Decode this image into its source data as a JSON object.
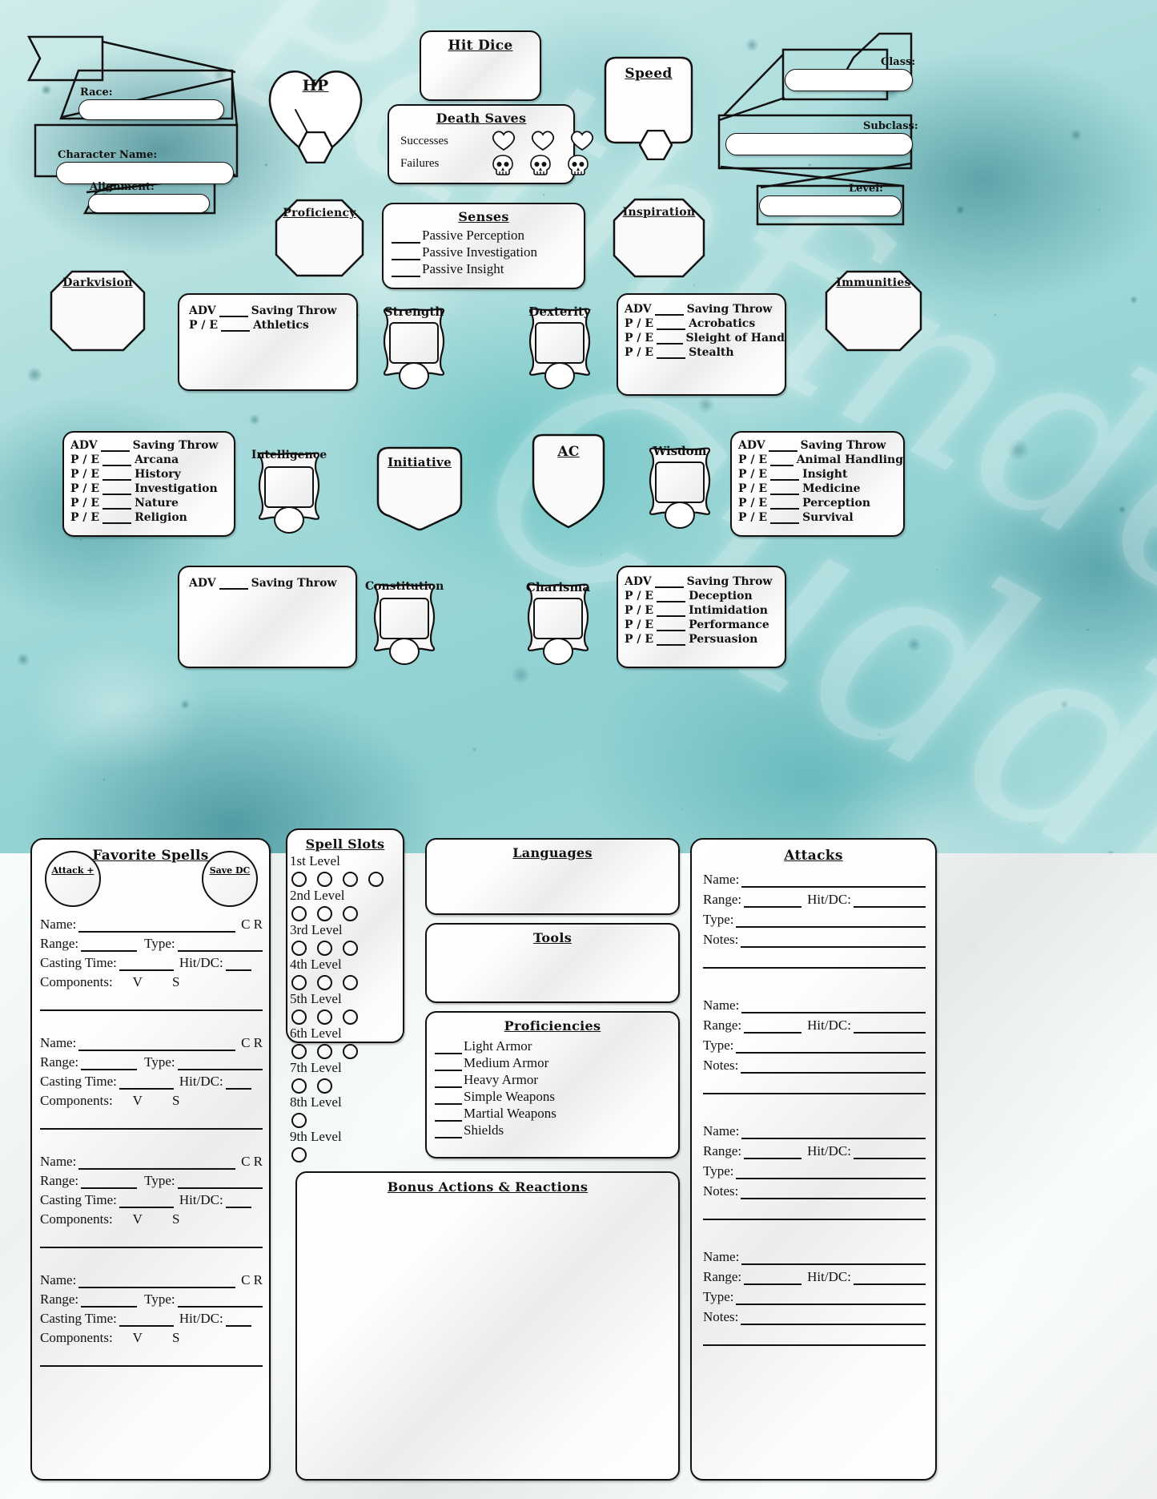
{
  "theme": {
    "accent": "#1a7d8a",
    "ink": "#111111",
    "paper": "#ffffff",
    "bg_teal_dark": "#0d5560",
    "bg_teal_mid": "#3aa3a6",
    "bg_teal_light": "#cfeceb"
  },
  "watermark": {
    "line1": "Pathfinder",
    "line2": "Cuddle"
  },
  "identity": {
    "race_label": "Race:",
    "character_name_label": "Character Name:",
    "alignment_label": "Alignment:",
    "class_label": "Class:",
    "subclass_label": "Subclass:",
    "level_label": "Level:",
    "race_value": "",
    "character_name_value": "",
    "alignment_value": "",
    "class_value": "",
    "subclass_value": "",
    "level_value": ""
  },
  "vitals": {
    "hp_title": "HP",
    "hp_current": "",
    "hp_max": "",
    "hp_temp": "",
    "hit_dice_title": "Hit Dice",
    "hit_dice_value": "",
    "speed_title": "Speed",
    "speed_value": "",
    "speed_bonus": "",
    "proficiency_title": "Proficiency",
    "proficiency_value": "",
    "inspiration_title": "Inspiration",
    "inspiration_value": "",
    "darkvision_title": "Darkvision",
    "darkvision_value": "",
    "immunities_title": "Immunities",
    "immunities_value": "",
    "ac_title": "AC",
    "ac_value": "",
    "initiative_title": "Initiative",
    "initiative_value": ""
  },
  "death_saves": {
    "title": "Death Saves",
    "successes_label": "Successes",
    "failures_label": "Failures",
    "success_count": 3,
    "failure_count": 3,
    "success_icon": "heart-icon",
    "failure_icon": "skull-icon"
  },
  "senses": {
    "title": "Senses",
    "items": [
      "Passive Perception",
      "Passive Investigation",
      "Passive Insight"
    ]
  },
  "abilities": [
    {
      "name": "Strength",
      "score": "",
      "modifier": ""
    },
    {
      "name": "Dexterity",
      "score": "",
      "modifier": ""
    },
    {
      "name": "Intelligence",
      "score": "",
      "modifier": ""
    },
    {
      "name": "Wisdom",
      "score": "",
      "modifier": ""
    },
    {
      "name": "Constitution",
      "score": "",
      "modifier": ""
    },
    {
      "name": "Charisma",
      "score": "",
      "modifier": ""
    }
  ],
  "skill_blocks": {
    "adv_prefix": "ADV",
    "pe_prefix": "P / E",
    "saving_throw_label": "Saving Throw",
    "strength": {
      "ability": "Strength",
      "skills": [
        "Athletics"
      ]
    },
    "dexterity": {
      "ability": "Dexterity",
      "skills": [
        "Acrobatics",
        "Sleight of Hand",
        "Stealth"
      ]
    },
    "intelligence": {
      "ability": "Intelligence",
      "skills": [
        "Arcana",
        "History",
        "Investigation",
        "Nature",
        "Religion"
      ]
    },
    "wisdom": {
      "ability": "Wisdom",
      "skills": [
        "Animal Handling",
        "Insight",
        "Medicine",
        "Perception",
        "Survival"
      ]
    },
    "constitution": {
      "ability": "Constitution",
      "skills": []
    },
    "charisma": {
      "ability": "Charisma",
      "skills": [
        "Deception",
        "Intimidation",
        "Performance",
        "Persuasion"
      ]
    }
  },
  "favorite_spells": {
    "title": "Favorite Spells",
    "attack_label": "Attack +",
    "attack_value": "",
    "save_dc_label": "Save DC",
    "save_dc_value": "",
    "cr_label": "C R",
    "entry_fields": {
      "name": "Name:",
      "range": "Range:",
      "type": "Type:",
      "casting_time": "Casting Time:",
      "hit_dc": "Hit/DC:",
      "components": "Components:",
      "component_v": "V",
      "component_s": "S"
    },
    "entry_count": 4
  },
  "spell_slots": {
    "title": "Spell Slots",
    "levels": [
      {
        "label": "1st Level",
        "slots": 4
      },
      {
        "label": "2nd Level",
        "slots": 3
      },
      {
        "label": "3rd Level",
        "slots": 3
      },
      {
        "label": "4th Level",
        "slots": 3
      },
      {
        "label": "5th Level",
        "slots": 3
      },
      {
        "label": "6th Level",
        "slots": 3
      },
      {
        "label": "7th Level",
        "slots": 2
      },
      {
        "label": "8th Level",
        "slots": 1
      },
      {
        "label": "9th Level",
        "slots": 1
      }
    ]
  },
  "languages": {
    "title": "Languages",
    "value": ""
  },
  "tools": {
    "title": "Tools",
    "value": ""
  },
  "proficiencies": {
    "title": "Proficiencies",
    "items": [
      "Light Armor",
      "Medium Armor",
      "Heavy Armor",
      "Simple Weapons",
      "Martial Weapons",
      "Shields"
    ]
  },
  "bonus_actions": {
    "title": "Bonus Actions & Reactions",
    "value": ""
  },
  "attacks": {
    "title": "Attacks",
    "entry_fields": {
      "name": "Name:",
      "range": "Range:",
      "hit_dc": "Hit/DC:",
      "type": "Type:",
      "notes": "Notes:"
    },
    "entry_count": 4
  }
}
